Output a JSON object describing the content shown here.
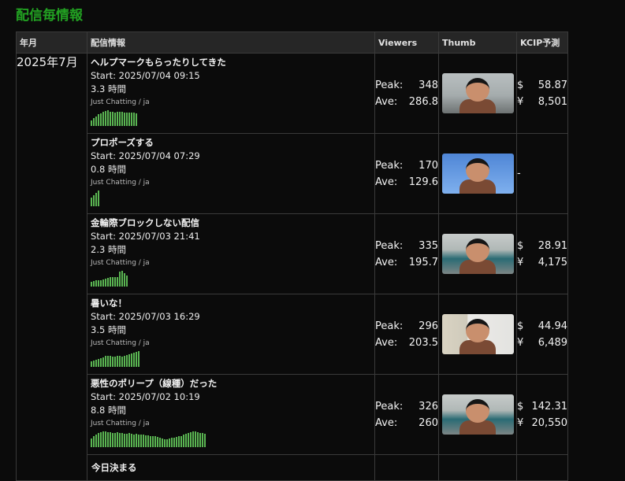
{
  "page_title": "配信毎情報",
  "columns": [
    "年月",
    "配信情報",
    "Viewers",
    "Thumb",
    "KCIP予測"
  ],
  "month": "2025年7月",
  "viewers_labels": {
    "peak": "Peak:",
    "ave": "Ave:"
  },
  "currency": {
    "usd": "$",
    "jpy": "¥"
  },
  "colors": {
    "title": "#22a122",
    "sparkline": "#5ab552",
    "header_bg": "#262626"
  },
  "streams": [
    {
      "title": "ヘルプマークもらったりしてきた",
      "start": "Start: 2025/07/04 09:15",
      "duration": "3.3 時間",
      "category": "Just Chatting / ja",
      "peak": "348",
      "ave": "286.8",
      "thumb": "indoor-room",
      "kcip_usd": "58.87",
      "kcip_jpy": "8,501",
      "spark": [
        0.35,
        0.5,
        0.62,
        0.75,
        0.82,
        0.9,
        0.95,
        1,
        0.92,
        0.88,
        0.85,
        0.9,
        0.92,
        0.88,
        0.86,
        0.85,
        0.87,
        0.84,
        0.83,
        0.82
      ]
    },
    {
      "title": "プロポーズする",
      "start": "Start: 2025/07/04 07:29",
      "duration": "0.8 時間",
      "category": "Just Chatting / ja",
      "peak": "170",
      "ave": "129.6",
      "thumb": "outdoor-sky",
      "kcip_na": "-",
      "spark": [
        0.55,
        0.7,
        0.85,
        1
      ]
    },
    {
      "title": "金輪際ブロックしない配信",
      "start": "Start: 2025/07/03 21:41",
      "duration": "2.3 時間",
      "category": "Just Chatting / ja",
      "peak": "335",
      "ave": "195.7",
      "thumb": "teal-wall",
      "kcip_usd": "28.91",
      "kcip_jpy": "4,175",
      "spark": [
        0.3,
        0.35,
        0.38,
        0.4,
        0.42,
        0.45,
        0.5,
        0.55,
        0.6,
        0.58,
        0.62,
        0.6,
        0.95,
        1,
        0.85,
        0.7
      ]
    },
    {
      "title": "暑いな！",
      "start": "Start: 2025/07/03 16:29",
      "duration": "3.5 時間",
      "category": "Just Chatting / ja",
      "peak": "296",
      "ave": "203.5",
      "thumb": "shelf-room",
      "kcip_usd": "44.94",
      "kcip_jpy": "6,489",
      "spark": [
        0.35,
        0.4,
        0.45,
        0.5,
        0.55,
        0.62,
        0.7,
        0.72,
        0.68,
        0.66,
        0.65,
        0.7,
        0.68,
        0.66,
        0.7,
        0.75,
        0.8,
        0.85,
        0.9,
        0.95,
        1
      ]
    },
    {
      "title": "悪性のポリープ（線種）だった",
      "start": "Start: 2025/07/02 10:19",
      "duration": "8.8 時間",
      "category": "Just Chatting / ja",
      "peak": "326",
      "ave": "260",
      "thumb": "teal-wall",
      "kcip_usd": "142.31",
      "kcip_jpy": "20,550",
      "spark": [
        0.55,
        0.7,
        0.8,
        0.9,
        0.95,
        1,
        0.98,
        0.95,
        0.96,
        0.92,
        0.9,
        0.94,
        0.9,
        0.88,
        0.86,
        0.85,
        0.88,
        0.84,
        0.82,
        0.83,
        0.8,
        0.82,
        0.78,
        0.75,
        0.76,
        0.72,
        0.7,
        0.68,
        0.66,
        0.6,
        0.55,
        0.5,
        0.52,
        0.55,
        0.58,
        0.6,
        0.65,
        0.7,
        0.72,
        0.78,
        0.85,
        0.9,
        0.95,
        1,
        0.98,
        0.95,
        0.9,
        0.88,
        0.86
      ]
    }
  ],
  "partial_row_title": "今日決まる"
}
